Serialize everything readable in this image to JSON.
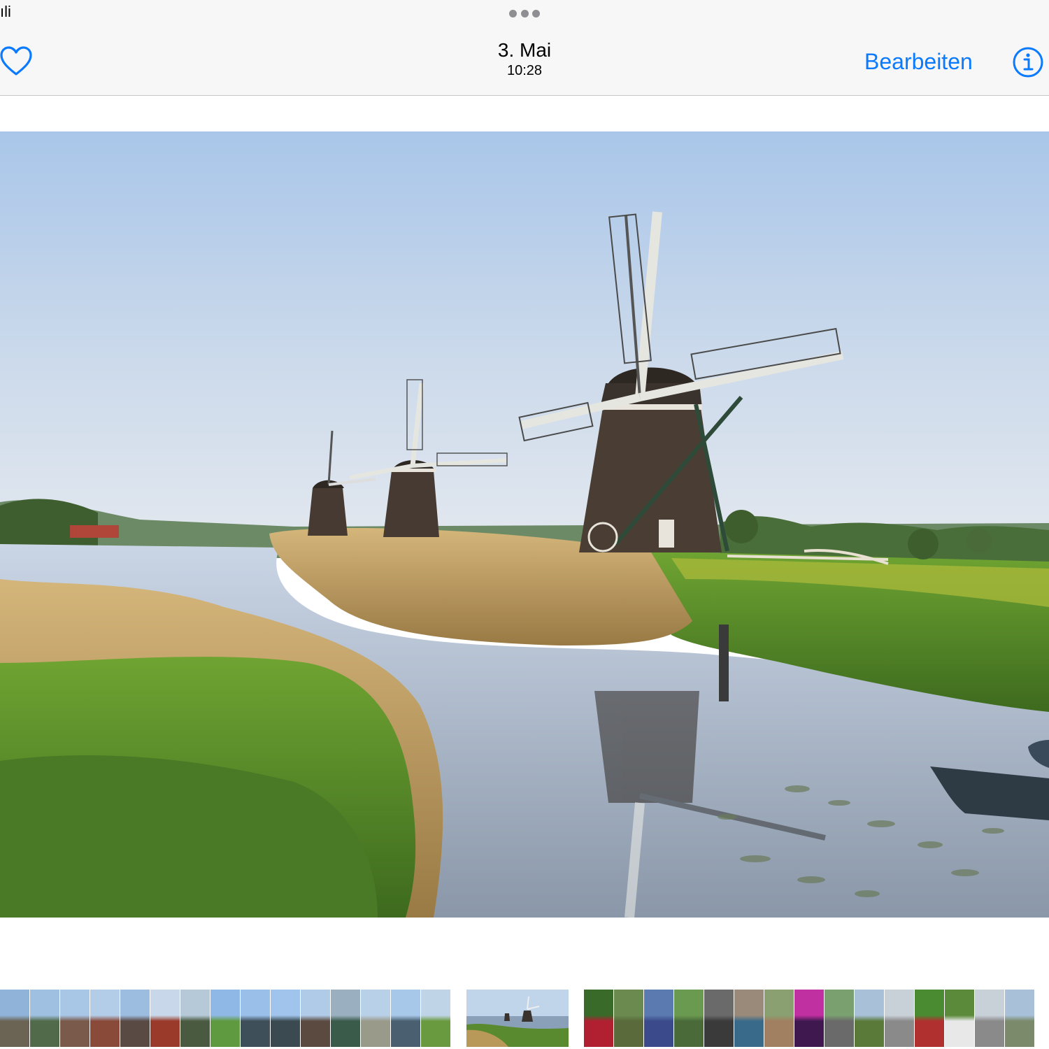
{
  "status_bar": {
    "left_text": "ıli"
  },
  "nav": {
    "date": "3. Mai",
    "time": "10:28",
    "edit_label": "Bearbeiten",
    "favorite_icon": "heart-icon",
    "info_icon": "info-icon",
    "multitask_icon": "more-dots-icon",
    "accent_color": "#0a7aff"
  },
  "photo": {
    "subject_icon": "windmill-landscape"
  },
  "filmstrip": {
    "thumbnails": [
      {
        "sky": "#8fb3d9",
        "ground": "#6b6455"
      },
      {
        "sky": "#9fc0e0",
        "ground": "#506a4a"
      },
      {
        "sky": "#a8c6e6",
        "ground": "#7a5a4a"
      },
      {
        "sky": "#b3cde8",
        "ground": "#8a4a3a"
      },
      {
        "sky": "#9cbde0",
        "ground": "#5a4a44"
      },
      {
        "sky": "#c8d8ea",
        "ground": "#9a3a2a"
      },
      {
        "sky": "#b5c9d8",
        "ground": "#4a5a40"
      },
      {
        "sky": "#8fb8e6",
        "ground": "#5f9a40"
      },
      {
        "sky": "#9ac0ea",
        "ground": "#3f4f5a"
      },
      {
        "sky": "#a0c4ec",
        "ground": "#3a4a50"
      },
      {
        "sky": "#b0cbe8",
        "ground": "#5a4a40"
      },
      {
        "sky": "#9ab0c0",
        "ground": "#3a5a4a"
      },
      {
        "sky": "#b8d0e8",
        "ground": "#9a9a8a"
      },
      {
        "sky": "#a8c8ea",
        "ground": "#4a6070"
      },
      {
        "sky": "#c0d4e8",
        "ground": "#6a9a40"
      },
      {
        "sky": "#c8d8e8",
        "ground": "#5a8a40"
      },
      {
        "sky": "#3a6a2a",
        "ground": "#b02030"
      },
      {
        "sky": "#6a8a50",
        "ground": "#5a6a3a"
      },
      {
        "sky": "#5a7ab0",
        "ground": "#3a4a8a"
      },
      {
        "sky": "#6a9a50",
        "ground": "#4a6a3a"
      },
      {
        "sky": "#6a6a6a",
        "ground": "#3a3a3a"
      },
      {
        "sky": "#9a8a7a",
        "ground": "#3a6a8a"
      },
      {
        "sky": "#8aa070",
        "ground": "#a08060"
      },
      {
        "sky": "#c030a0",
        "ground": "#401850"
      },
      {
        "sky": "#7aa070",
        "ground": "#6a6a6a"
      },
      {
        "sky": "#a8c0d8",
        "ground": "#5a7a3a"
      },
      {
        "sky": "#c8d0d8",
        "ground": "#8a8a8a"
      },
      {
        "sky": "#4a8a30",
        "ground": "#b03030"
      },
      {
        "sky": "#5a8a3a",
        "ground": "#e8e8e8"
      },
      {
        "sky": "#c8d0d8",
        "ground": "#8a8a8a"
      },
      {
        "sky": "#a8c0d8",
        "ground": "#7a8a6a"
      }
    ]
  }
}
